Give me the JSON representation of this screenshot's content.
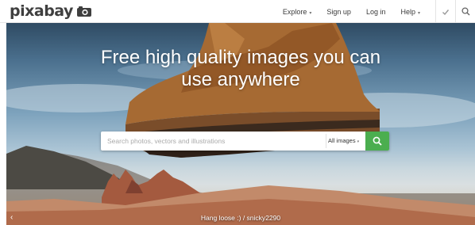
{
  "logo": {
    "text": "pixabay"
  },
  "nav": {
    "explore": "Explore",
    "signup": "Sign up",
    "login": "Log in",
    "help": "Help",
    "caret": "▾",
    "icons": [
      "checkmark-icon",
      "search-icon"
    ]
  },
  "hero": {
    "headline_line1": "Free high quality images you can",
    "headline_line2": "use anywhere",
    "search_placeholder": "Search photos, vectors and illustrations",
    "filter_label": "All images",
    "credit": "Hang loose :) / snicky2290",
    "prev": "‹"
  },
  "colors": {
    "accent": "#4bae4f",
    "nav_text": "#3a3a3a"
  }
}
